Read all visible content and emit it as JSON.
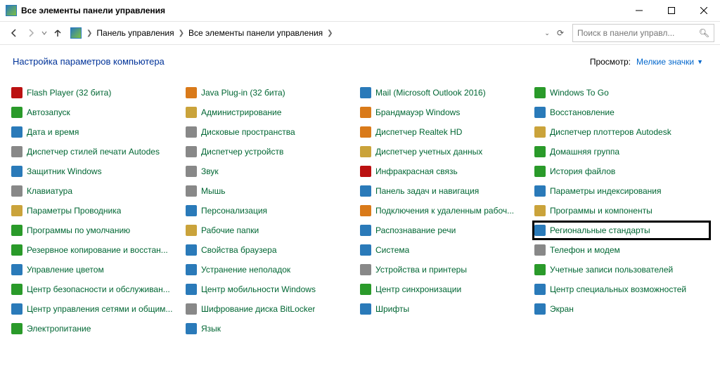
{
  "window": {
    "title": "Все элементы панели управления"
  },
  "breadcrumb": {
    "root": "Панель управления",
    "current": "Все элементы панели управления"
  },
  "search": {
    "placeholder": "Поиск в панели управл..."
  },
  "header": {
    "title": "Настройка параметров компьютера",
    "view_label": "Просмотр:",
    "view_value": "Мелкие значки"
  },
  "items": [
    {
      "label": "Flash Player (32 бита)",
      "icon": "#b11"
    },
    {
      "label": "Java Plug-in (32 бита)",
      "icon": "#d97a1a"
    },
    {
      "label": "Mail (Microsoft Outlook 2016)",
      "icon": "#2a7ab9"
    },
    {
      "label": "Windows To Go",
      "icon": "#2a9a2a"
    },
    {
      "label": "Автозапуск",
      "icon": "#2a9a2a"
    },
    {
      "label": "Администрирование",
      "icon": "#caa33b"
    },
    {
      "label": "Брандмауэр Windows",
      "icon": "#d97a1a"
    },
    {
      "label": "Восстановление",
      "icon": "#2a7ab9"
    },
    {
      "label": "Дата и время",
      "icon": "#2a7ab9"
    },
    {
      "label": "Дисковые пространства",
      "icon": "#888"
    },
    {
      "label": "Диспетчер Realtek HD",
      "icon": "#d97a1a"
    },
    {
      "label": "Диспетчер плоттеров Autodesk",
      "icon": "#caa33b"
    },
    {
      "label": "Диспетчер стилей печати Autodes",
      "icon": "#888"
    },
    {
      "label": "Диспетчер устройств",
      "icon": "#888"
    },
    {
      "label": "Диспетчер учетных данных",
      "icon": "#caa33b"
    },
    {
      "label": "Домашняя группа",
      "icon": "#2a9a2a"
    },
    {
      "label": "Защитник Windows",
      "icon": "#2a7ab9"
    },
    {
      "label": "Звук",
      "icon": "#888"
    },
    {
      "label": "Инфракрасная связь",
      "icon": "#b11"
    },
    {
      "label": "История файлов",
      "icon": "#2a9a2a"
    },
    {
      "label": "Клавиатура",
      "icon": "#888"
    },
    {
      "label": "Мышь",
      "icon": "#888"
    },
    {
      "label": "Панель задач и навигация",
      "icon": "#2a7ab9"
    },
    {
      "label": "Параметры индексирования",
      "icon": "#2a7ab9"
    },
    {
      "label": "Параметры Проводника",
      "icon": "#caa33b"
    },
    {
      "label": "Персонализация",
      "icon": "#2a7ab9"
    },
    {
      "label": "Подключения к удаленным рабоч...",
      "icon": "#d97a1a"
    },
    {
      "label": "Программы и компоненты",
      "icon": "#caa33b"
    },
    {
      "label": "Программы по умолчанию",
      "icon": "#2a9a2a"
    },
    {
      "label": "Рабочие папки",
      "icon": "#caa33b"
    },
    {
      "label": "Распознавание речи",
      "icon": "#2a7ab9"
    },
    {
      "label": "Региональные стандарты",
      "icon": "#2a7ab9",
      "highlight": true
    },
    {
      "label": "Резервное копирование и восстан...",
      "icon": "#2a9a2a"
    },
    {
      "label": "Свойства браузера",
      "icon": "#2a7ab9"
    },
    {
      "label": "Система",
      "icon": "#2a7ab9"
    },
    {
      "label": "Телефон и модем",
      "icon": "#888"
    },
    {
      "label": "Управление цветом",
      "icon": "#2a7ab9"
    },
    {
      "label": "Устранение неполадок",
      "icon": "#2a7ab9"
    },
    {
      "label": "Устройства и принтеры",
      "icon": "#888"
    },
    {
      "label": "Учетные записи пользователей",
      "icon": "#2a9a2a"
    },
    {
      "label": "Центр безопасности и обслуживан...",
      "icon": "#2a9a2a"
    },
    {
      "label": "Центр мобильности Windows",
      "icon": "#2a7ab9"
    },
    {
      "label": "Центр синхронизации",
      "icon": "#2a9a2a"
    },
    {
      "label": "Центр специальных возможностей",
      "icon": "#2a7ab9"
    },
    {
      "label": "Центр управления сетями и общим...",
      "icon": "#2a7ab9"
    },
    {
      "label": "Шифрование диска BitLocker",
      "icon": "#888"
    },
    {
      "label": "Шрифты",
      "icon": "#2a7ab9"
    },
    {
      "label": "Экран",
      "icon": "#2a7ab9"
    },
    {
      "label": "Электропитание",
      "icon": "#2a9a2a"
    },
    {
      "label": "Язык",
      "icon": "#2a7ab9"
    }
  ]
}
